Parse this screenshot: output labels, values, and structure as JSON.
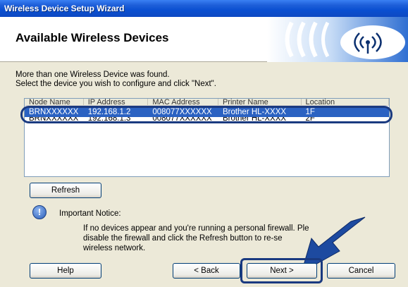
{
  "window": {
    "title": "Wireless Device Setup Wizard"
  },
  "banner": {
    "title": "Available Wireless Devices"
  },
  "message": {
    "line1": "More than one Wireless Device was found.",
    "line2": "Select the device you wish to configure and click \"Next\"."
  },
  "list": {
    "columns": [
      "Node Name",
      "IP Address",
      "MAC Address",
      "Printer Name",
      "Location"
    ],
    "rows": [
      [
        "BRNXXXXXX",
        "192.168.1.2",
        "008077XXXXXX",
        "Brother HL-XXXX",
        "1F"
      ],
      [
        "BRNXXXXXX",
        "192.168.1.3",
        "008077XXXXXX",
        "Brother HL-XXXX",
        "2F"
      ]
    ],
    "selected_index": 0
  },
  "buttons": {
    "refresh": "Refresh",
    "help": "Help",
    "back": "< Back",
    "next": "Next >",
    "cancel": "Cancel"
  },
  "notice": {
    "title": "Important Notice:",
    "line1": "If no devices appear and you're running a personal firewall. Ple",
    "line2": "disable the firewall and click the Refresh button to re-se",
    "line3": "wireless network."
  },
  "colors": {
    "titlebar": "#0a4fd1",
    "selection": "#2b62c2",
    "highlight_outline": "#1a3a80",
    "arrow": "#1d4aa0"
  },
  "icons": {
    "banner": "wireless-signal-icon",
    "notice": "exclamation-icon",
    "pointer": "arrow-pointer-icon"
  }
}
